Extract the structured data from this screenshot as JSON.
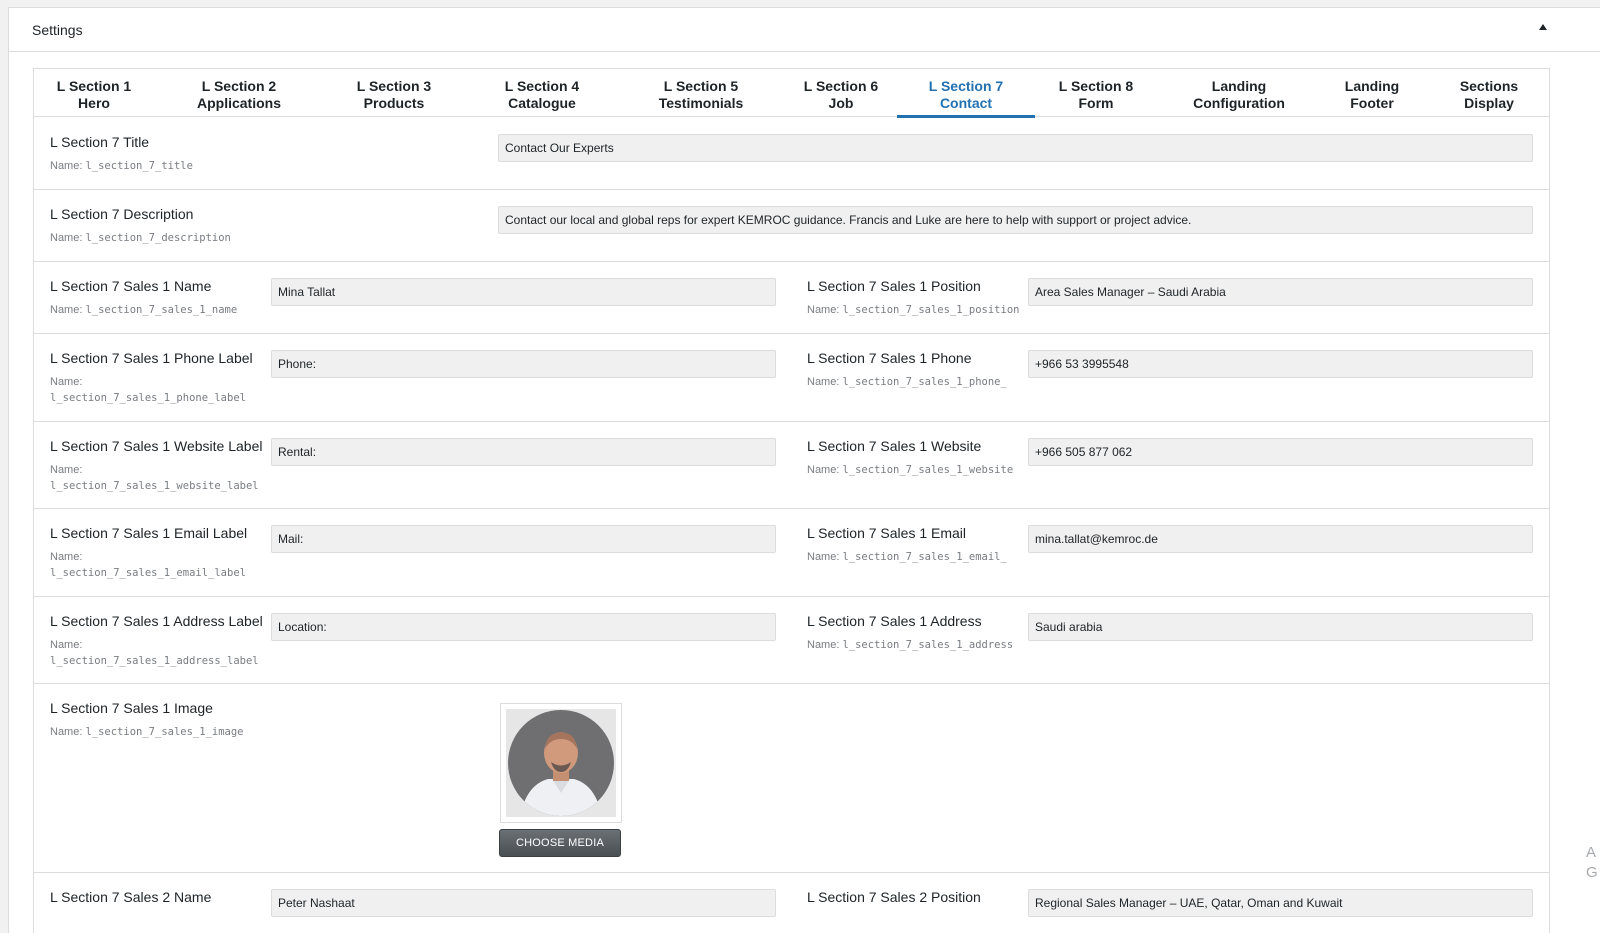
{
  "metabox": {
    "title": "Settings"
  },
  "tabs": [
    {
      "line1": "L Section 1",
      "line2": "Hero",
      "active": false
    },
    {
      "line1": "L Section 2",
      "line2": "Applications",
      "active": false
    },
    {
      "line1": "L Section 3",
      "line2": "Products",
      "active": false
    },
    {
      "line1": "L Section 4",
      "line2": "Catalogue",
      "active": false
    },
    {
      "line1": "L Section 5",
      "line2": "Testimonials",
      "active": false
    },
    {
      "line1": "L Section 6",
      "line2": "Job",
      "active": false
    },
    {
      "line1": "L Section 7",
      "line2": "Contact",
      "active": true
    },
    {
      "line1": "L Section 8",
      "line2": "Form",
      "active": false
    },
    {
      "line1": "Landing",
      "line2": "Configuration",
      "active": false
    },
    {
      "line1": "Landing",
      "line2": "Footer",
      "active": false
    },
    {
      "line1": "Sections",
      "line2": "Display",
      "active": false
    }
  ],
  "fields": {
    "title": {
      "label": "L Section 7 Title",
      "name_prefix": "Name:",
      "name": "l_section_7_title",
      "value": "Contact Our Experts"
    },
    "description": {
      "label": "L Section 7 Description",
      "name_prefix": "Name:",
      "name": "l_section_7_description",
      "value": "Contact our local and global reps for expert KEMROC guidance. Francis and Luke are here to help with support or project advice."
    },
    "sales1_name": {
      "label": "L Section 7 Sales 1 Name",
      "name_prefix": "Name:",
      "name": "l_section_7_sales_1_name",
      "value": "Mina Tallat"
    },
    "sales1_position": {
      "label": "L Section 7 Sales 1 Position",
      "name_prefix": "Name:",
      "name": "l_section_7_sales_1_position",
      "value": "Area Sales Manager – Saudi Arabia"
    },
    "sales1_phone_label": {
      "label": "L Section 7 Sales 1 Phone Label",
      "name_prefix": "Name:",
      "name": "l_section_7_sales_1_phone_label",
      "value": "Phone:"
    },
    "sales1_phone": {
      "label": "L Section 7 Sales 1 Phone",
      "name_prefix": "Name:",
      "name": "l_section_7_sales_1_phone_",
      "value": "+966 53 3995548"
    },
    "sales1_website_label": {
      "label": "L Section 7 Sales 1 Website Label",
      "name_prefix": "Name:",
      "name": "l_section_7_sales_1_website_label",
      "value": "Rental:"
    },
    "sales1_website": {
      "label": "L Section 7 Sales 1 Website",
      "name_prefix": "Name:",
      "name": "l_section_7_sales_1_website",
      "value": "+966 505 877 062"
    },
    "sales1_email_label": {
      "label": "L Section 7 Sales 1 Email Label",
      "name_prefix": "Name:",
      "name": "l_section_7_sales_1_email_label",
      "value": "Mail:"
    },
    "sales1_email": {
      "label": "L Section 7 Sales 1 Email",
      "name_prefix": "Name:",
      "name": "l_section_7_sales_1_email_",
      "value": "mina.tallat@kemroc.de"
    },
    "sales1_address_label": {
      "label": "L Section 7 Sales 1 Address Label",
      "name_prefix": "Name:",
      "name": "l_section_7_sales_1_address_label",
      "value": "Location:"
    },
    "sales1_address": {
      "label": "L Section 7 Sales 1 Address",
      "name_prefix": "Name:",
      "name": "l_section_7_sales_1_address",
      "value": "Saudi arabia"
    },
    "sales1_image": {
      "label": "L Section 7 Sales 1 Image",
      "name_prefix": "Name:",
      "name": "l_section_7_sales_1_image",
      "button": "CHOOSE MEDIA"
    },
    "sales2_name": {
      "label": "L Section 7 Sales 2 Name",
      "value": "Peter Nashaat"
    },
    "sales2_position": {
      "label": "L Section 7 Sales 2 Position",
      "value": "Regional Sales Manager – UAE, Qatar, Oman and Kuwait"
    }
  },
  "colors": {
    "accent": "#2271b1",
    "input_bg": "#f0f0f0",
    "border": "#dcdcde"
  },
  "icons": {
    "collapse": "triangle-up-icon",
    "media_preview": "person-photo"
  },
  "edge_hint": {
    "line1": "A",
    "line2": "G"
  }
}
